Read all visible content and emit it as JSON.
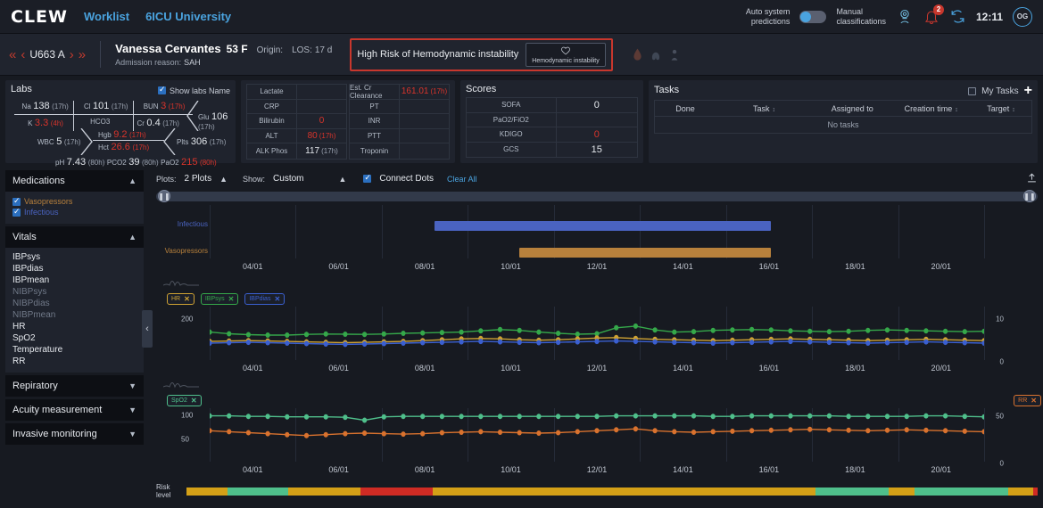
{
  "header": {
    "logo": "CLEW",
    "nav": [
      {
        "label": "Worklist"
      },
      {
        "label": "6ICU University"
      }
    ],
    "auto_predictions_label": "Auto system\npredictions",
    "auto_predictions_line1": "Auto system",
    "auto_predictions_line2": "predictions",
    "manual_class_line1": "Manual",
    "manual_class_line2": "classifications",
    "notification_count": "2",
    "clock": "12:11",
    "avatar_initials": "OG",
    "accent_blue": "#4aa3df",
    "alert_red": "#c8372d"
  },
  "patient": {
    "id": "U663 A",
    "name": "Vanessa Cervantes",
    "age_sex": "53 F",
    "origin_label": "Origin:",
    "los_label": "LOS:",
    "los_value": "17 d",
    "admission_label": "Admission reason:",
    "admission_value": "SAH",
    "alert_text": "High Risk of Hemodynamic instability",
    "alert_chip_label": "Hemodynamic instability"
  },
  "labs": {
    "title": "Labs",
    "show_labs_name": "Show labs Name",
    "show_labs_checked": true,
    "fishbone": {
      "na": {
        "name": "Na",
        "value": "138",
        "time": "(17h)"
      },
      "cl": {
        "name": "Cl",
        "value": "101",
        "time": "(17h)"
      },
      "bun": {
        "name": "BUN",
        "value": "3",
        "time": "(17h)",
        "abnormal": true
      },
      "glu": {
        "name": "Glu",
        "value": "106",
        "time": "(17h)"
      },
      "k": {
        "name": "K",
        "value": "3.3",
        "time": "(4h)",
        "abnormal": true
      },
      "hco3": {
        "name": "HCO3",
        "value": "",
        "time": ""
      },
      "cr": {
        "name": "Cr",
        "value": "0.4",
        "time": "(17h)"
      },
      "wbc": {
        "name": "WBC",
        "value": "5",
        "time": "(17h)"
      },
      "hgb": {
        "name": "Hgb",
        "value": "9.2",
        "time": "(17h)",
        "abnormal": true
      },
      "hct": {
        "name": "Hct",
        "value": "26.6",
        "time": "(17h)",
        "abnormal": true
      },
      "plts": {
        "name": "Plts",
        "value": "306",
        "time": "(17h)"
      },
      "ph": {
        "name": "pH",
        "value": "7.43",
        "time": "(80h)"
      },
      "pco2": {
        "name": "PCO2",
        "value": "39",
        "time": "(80h)"
      },
      "pao2": {
        "name": "PaO2",
        "value": "215",
        "time": "(80h)",
        "abnormal": true
      }
    },
    "table_left": [
      {
        "key": "Lactate",
        "value": "",
        "time": "",
        "abnormal": false
      },
      {
        "key": "CRP",
        "value": "",
        "time": "",
        "abnormal": false
      },
      {
        "key": "Bilirubin",
        "value": "0",
        "time": "",
        "abnormal": true
      },
      {
        "key": "ALT",
        "value": "80",
        "time": "(17h)",
        "abnormal": true
      },
      {
        "key": "ALK Phos",
        "value": "117",
        "time": "(17h)",
        "abnormal": false
      }
    ],
    "table_right": [
      {
        "key": "Est. Cr Clearance",
        "value": "161.01",
        "time": "(17h)",
        "abnormal": true
      },
      {
        "key": "PT",
        "value": "",
        "time": "",
        "abnormal": false
      },
      {
        "key": "INR",
        "value": "",
        "time": "",
        "abnormal": false
      },
      {
        "key": "PTT",
        "value": "",
        "time": "",
        "abnormal": false
      },
      {
        "key": "Troponin",
        "value": "",
        "time": "",
        "abnormal": false
      }
    ]
  },
  "scores": {
    "title": "Scores",
    "rows": [
      {
        "key": "SOFA",
        "value": "0",
        "abnormal": false
      },
      {
        "key": "PaO2/FiO2",
        "value": "",
        "abnormal": false
      },
      {
        "key": "KDIGO",
        "value": "0",
        "abnormal": true
      },
      {
        "key": "GCS",
        "value": "15",
        "abnormal": false
      }
    ]
  },
  "tasks": {
    "title": "Tasks",
    "my_tasks_label": "My Tasks",
    "my_tasks_checked": false,
    "add_label": "+",
    "columns": [
      "Done",
      "Task",
      "Assigned to",
      "Creation time",
      "Target"
    ],
    "empty_text": "No tasks"
  },
  "sidebar": {
    "sections": [
      {
        "title": "Medications",
        "expanded": true
      },
      {
        "title": "Vitals",
        "expanded": true
      },
      {
        "title": "Repiratory",
        "expanded": false
      },
      {
        "title": "Acuity measurement",
        "expanded": false
      },
      {
        "title": "Invasive monitoring",
        "expanded": false
      }
    ],
    "medications": [
      {
        "label": "Vasopressors",
        "checked": true,
        "color": "#b8813c"
      },
      {
        "label": "Infectious",
        "checked": true,
        "color": "#4a63c0"
      }
    ],
    "vitals": [
      {
        "label": "IBPsys",
        "active": true
      },
      {
        "label": "IBPdias",
        "active": true
      },
      {
        "label": "IBPmean",
        "active": true
      },
      {
        "label": "NIBPsys",
        "active": false
      },
      {
        "label": "NIBPdias",
        "active": false
      },
      {
        "label": "NIBPmean",
        "active": false
      },
      {
        "label": "HR",
        "active": true
      },
      {
        "label": "SpO2",
        "active": true
      },
      {
        "label": "Temperature",
        "active": true
      },
      {
        "label": "RR",
        "active": true
      }
    ]
  },
  "plot_tools": {
    "plots_label": "Plots:",
    "plots_value": "2 Plots",
    "show_label": "Show:",
    "show_value": "Custom",
    "connect_dots_label": "Connect Dots",
    "connect_dots_checked": true,
    "clear_all_label": "Clear All"
  },
  "chart_data": [
    {
      "type": "bar",
      "name": "medication-timeline",
      "title": "",
      "categories": [
        "Infectious",
        "Vasopressors"
      ],
      "series": [
        {
          "name": "Infectious",
          "color": "#4a63c0",
          "start": "06/22",
          "end": "14/12",
          "start_pct": 29.0,
          "end_pct": 72.5
        },
        {
          "name": "Vasopressors",
          "color": "#b8813c",
          "start": "08/20",
          "end": "14/12",
          "start_pct": 40.0,
          "end_pct": 72.5
        }
      ],
      "xlabel": "",
      "ylabel": "",
      "x_ticks": [
        "04/01",
        "06/01",
        "08/01",
        "10/01",
        "12/01",
        "14/01",
        "16/01",
        "18/01",
        "20/01"
      ],
      "grid": true,
      "legend": "left"
    },
    {
      "type": "line",
      "name": "vitals-plot-1",
      "title": "",
      "legend_chips": [
        {
          "label": "HR",
          "color": "#cfa233"
        },
        {
          "label": "IBPsys",
          "color": "#35a84a"
        },
        {
          "label": "IBPdias",
          "color": "#3a5fd0"
        }
      ],
      "x_ticks": [
        "04/01",
        "06/01",
        "08/01",
        "10/01",
        "12/01",
        "14/01",
        "16/01",
        "18/01",
        "20/01"
      ],
      "y_left_ticks": [
        "200"
      ],
      "y_right_ticks": [
        "10",
        "0"
      ],
      "ylim": [
        0,
        260
      ],
      "series": [
        {
          "name": "IBPsys",
          "color": "#35a84a",
          "values": [
            140,
            132,
            128,
            126,
            126,
            129,
            131,
            130,
            129,
            131,
            134,
            136,
            138,
            140,
            146,
            152,
            148,
            140,
            134,
            130,
            132,
            160,
            168,
            150,
            140,
            142,
            148,
            150,
            152,
            150,
            146,
            144,
            142,
            144,
            148,
            150,
            148,
            146,
            144,
            142,
            144
          ]
        },
        {
          "name": "HR",
          "color": "#cfa233",
          "values": [
            96,
            98,
            100,
            98,
            96,
            94,
            92,
            90,
            92,
            94,
            96,
            100,
            104,
            108,
            110,
            108,
            104,
            102,
            104,
            108,
            112,
            114,
            110,
            106,
            104,
            102,
            100,
            102,
            104,
            106,
            108,
            106,
            104,
            102,
            100,
            102,
            104,
            106,
            104,
            102,
            100
          ]
        },
        {
          "name": "IBPdias",
          "color": "#3a5fd0",
          "values": [
            88,
            90,
            92,
            90,
            88,
            86,
            84,
            82,
            84,
            86,
            88,
            90,
            92,
            94,
            96,
            94,
            92,
            90,
            92,
            94,
            96,
            98,
            96,
            94,
            92,
            90,
            88,
            90,
            92,
            94,
            96,
            94,
            92,
            90,
            88,
            90,
            92,
            94,
            92,
            90,
            88
          ]
        }
      ],
      "grid": true
    },
    {
      "type": "line",
      "name": "vitals-plot-2",
      "title": "",
      "legend_chips": [
        {
          "label": "SpO2",
          "color": "#4fbf8b"
        }
      ],
      "legend_chips_right": [
        {
          "label": "RR",
          "color": "#d9722e"
        }
      ],
      "x_ticks": [
        "04/01",
        "06/01",
        "08/01",
        "10/01",
        "12/01",
        "14/01",
        "16/01",
        "18/01",
        "20/01"
      ],
      "y_left_ticks": [
        "100",
        "50"
      ],
      "y_right_ticks": [
        "50",
        "0"
      ],
      "ylim": [
        0,
        115
      ],
      "series": [
        {
          "name": "SpO2",
          "color": "#4fbf8b",
          "values": [
            99,
            99,
            98,
            98,
            97,
            97,
            97,
            96,
            90,
            97,
            98,
            98,
            98,
            98,
            98,
            98,
            98,
            98,
            98,
            98,
            98,
            99,
            99,
            99,
            99,
            99,
            98,
            98,
            99,
            99,
            99,
            99,
            99,
            98,
            98,
            98,
            98,
            99,
            99,
            98,
            97
          ]
        },
        {
          "name": "RR",
          "color": "#d9722e",
          "values": [
            68,
            66,
            64,
            62,
            60,
            58,
            60,
            62,
            63,
            62,
            61,
            62,
            64,
            65,
            66,
            65,
            64,
            63,
            64,
            66,
            68,
            70,
            72,
            68,
            66,
            65,
            66,
            67,
            68,
            69,
            70,
            71,
            70,
            69,
            68,
            69,
            70,
            69,
            68,
            67,
            66
          ]
        }
      ],
      "grid": true
    }
  ],
  "risk": {
    "label": "Risk level",
    "segments": [
      {
        "color": "#d4a017",
        "width": 4.8
      },
      {
        "color": "#4fbf8b",
        "width": 7.2
      },
      {
        "color": "#d4a017",
        "width": 8.4
      },
      {
        "color": "#cf2b24",
        "width": 8.5
      },
      {
        "color": "#d4a017",
        "width": 23.0
      },
      {
        "color": "#d4a017",
        "width": 22.0
      },
      {
        "color": "#4fbf8b",
        "width": 8.6
      },
      {
        "color": "#d4a017",
        "width": 3.0
      },
      {
        "color": "#4fbf8b",
        "width": 11.0
      },
      {
        "color": "#d4a017",
        "width": 3.0
      },
      {
        "color": "#cf2b24",
        "width": 0.5
      }
    ]
  },
  "colors": {
    "bg": "#171a21",
    "panel": "#1f232d",
    "accent": "#4aa3df",
    "danger": "#d9342b"
  }
}
